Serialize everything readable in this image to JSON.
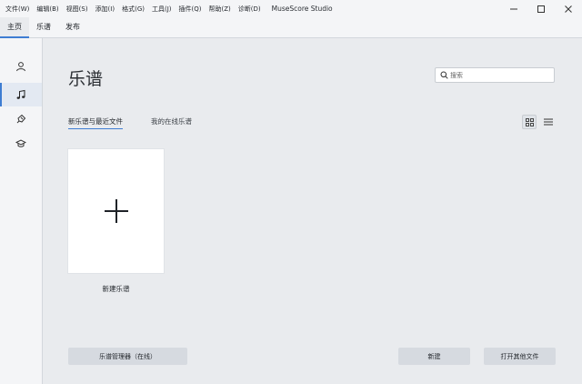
{
  "menubar": {
    "items": [
      "文件(W)",
      "编辑(B)",
      "视图(S)",
      "添加(I)",
      "格式(G)",
      "工具(J)",
      "插件(Q)",
      "帮助(Z)",
      "诊断(D)"
    ],
    "app_title": "MuseScore Studio"
  },
  "window_controls": [
    "minimize-icon",
    "maximize-icon",
    "close-icon"
  ],
  "tabs": [
    {
      "label": "主页",
      "active": true
    },
    {
      "label": "乐谱",
      "active": false
    },
    {
      "label": "发布",
      "active": false
    }
  ],
  "sidebar": {
    "items": [
      {
        "icon": "account-icon",
        "active": false
      },
      {
        "icon": "music-note-icon",
        "active": true
      },
      {
        "icon": "plugin-icon",
        "active": false
      },
      {
        "icon": "learn-icon",
        "active": false
      }
    ]
  },
  "main": {
    "title": "乐谱",
    "search": {
      "placeholder": "搜索",
      "value": ""
    },
    "subtabs": [
      {
        "label": "新乐谱与最近文件",
        "active": true
      },
      {
        "label": "我的在线乐谱",
        "active": false
      }
    ],
    "view_modes": [
      {
        "icon": "grid-view-icon",
        "active": true
      },
      {
        "icon": "list-view-icon",
        "active": false
      }
    ],
    "new_score_label": "新建乐谱"
  },
  "footer": {
    "manager_label": "乐谱管理器（在线）",
    "new_label": "新建",
    "open_label": "打开其他文件"
  },
  "colors": {
    "accent": "#3e7dd2",
    "background": "#e9ebee",
    "panel": "#f4f5f7",
    "button": "#d6dae0"
  }
}
